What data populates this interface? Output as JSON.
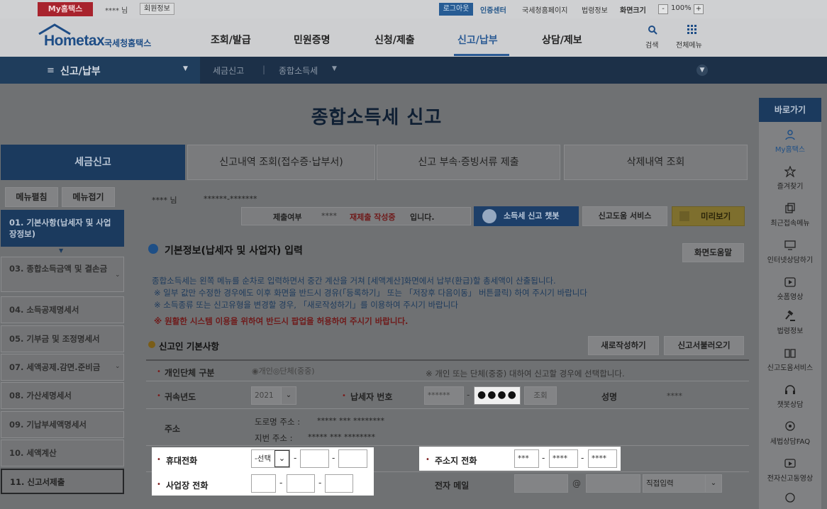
{
  "topbar": {
    "my_hometax": "My홈택스",
    "user_name": "**** 님",
    "member_info": "회원정보",
    "logout": "로그아웃",
    "cert_center": "인증센터",
    "nts_home": "국세청홈페이지",
    "law_info": "법령정보",
    "screen_size": "화면크기",
    "zoom_out": "-",
    "zoom_level": "100%",
    "zoom_in": "+"
  },
  "header": {
    "logo": "Hometax",
    "logo_sub": "국세청홈택스",
    "nav": [
      "조회/발급",
      "민원증명",
      "신청/제출",
      "신고/납부",
      "상담/제보"
    ],
    "active_nav": "신고/납부",
    "search_label": "검색",
    "allmenu_label": "전체메뉴"
  },
  "navbar": {
    "current": "신고/납부",
    "breadcrumb": [
      "세금신고",
      "종합소득세"
    ]
  },
  "page": {
    "title": "종합소득세 신고",
    "tabs": [
      "세금신고",
      "신고내역 조회(접수증·납부서)",
      "신고 부속·증빙서류 제출",
      "삭제내역 조회"
    ]
  },
  "sidebar": {
    "expand": "메뉴펼침",
    "collapse": "메뉴접기",
    "items": [
      "01. 기본사항(납세자 및 사업장정보)",
      "03. 종합소득금액 및 결손금",
      "04. 소득공제명세서",
      "05. 기부금 및 조정명세서",
      "07. 세액공제.감면.준비금",
      "08. 가산세명세서",
      "09. 기납부세액명세서",
      "10. 세액계산",
      "11. 신고서제출"
    ]
  },
  "content": {
    "taxpayer_name": "**** 님",
    "taxpayer_id": "******-*******",
    "status_label": "제출여부",
    "status_name": "****",
    "status_value": "재제출 작성중",
    "status_suffix": "입니다.",
    "chatbot": "소득세 신고 챗봇",
    "help_service": "신고도움 서비스",
    "preview": "미리보기",
    "section_title": "기본정보(납세자 및 사업자) 입력",
    "screen_help": "화면도움말",
    "notices": [
      "종합소득세는 왼쪽 메뉴를 순차로 입력하면서 중간 계산을 거쳐 [세액계산]화면에서 납부(환급)할 총세액이 산출됩니다.",
      "※ 일부 값만 수정한 경우에도 이후 화면을 반드시 경유(「등록하기」 또는 「저장후 다음이동」 버튼클릭) 하여 주시기 바랍니다",
      "※ 소득종류 또는 신고유형을 변경할 경우, 「새로작성하기」를 이용하여 주시기 바랍니다",
      "※ 원활한 시스템 이용을 위하여 반드시 팝업을 허용하여 주시기 바랍니다."
    ],
    "reporter_title": "신고인 기본사항",
    "new_write": "새로작성하기",
    "load_report": "신고서불러오기"
  },
  "form": {
    "type_label": "개인단체 구분",
    "type_radio": "◉개인◎단체(중중)",
    "type_note": "※ 개인 또는 단체(중중) 대하여 신고할 경우에 선택합니다.",
    "year_label": "귀속년도",
    "year_value": "2021",
    "tin_label": "납세자 번호",
    "tin_first": "******",
    "tin_second": "●●●●",
    "tin_lookup": "조회",
    "name_label": "성명",
    "name_value": "****",
    "address_label": "주소",
    "road_addr_label": "도로명 주소 :",
    "road_addr_value": "***** ***  ********",
    "lot_addr_label": "지번 주소 :",
    "lot_addr_value": "***** ***  ********",
    "mobile_label": "휴대전화",
    "mobile_select": "-선택",
    "biz_phone_label": "사업장 전화",
    "addr_phone_label": "주소지 전화",
    "addr_phone_1": "***",
    "addr_phone_2": "****",
    "addr_phone_3": "****",
    "email_label": "전자 메일",
    "email_at": "@",
    "email_select": "직접입력"
  },
  "quick": {
    "title": "바로가기",
    "items": [
      "My홈택스",
      "즐겨찾기",
      "최근접속메뉴",
      "인터넷상담하기",
      "숏폼영상",
      "법령정보",
      "신고도움서비스",
      "챗봇상담",
      "세법상담FAQ",
      "전자신고동영상"
    ]
  },
  "colors": {
    "brand_navy": "#1b3a5e",
    "my_hometax_red": "#a8232d",
    "warning_red": "#6f1a1a",
    "highlight_white": "#ffffff"
  }
}
